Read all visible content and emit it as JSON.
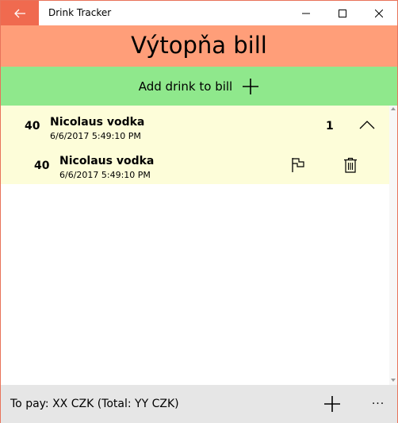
{
  "window": {
    "title": "Drink Tracker"
  },
  "header": {
    "title": "Výtopňa bill"
  },
  "add_bar": {
    "label": "Add drink to bill"
  },
  "group": {
    "quantity": "40",
    "name": "Nicolaus vodka",
    "time": "6/6/2017 5:49:10 PM",
    "count": "1"
  },
  "items": [
    {
      "quantity": "40",
      "name": "Nicolaus vodka",
      "time": "6/6/2017 5:49:10 PM"
    }
  ],
  "footer": {
    "to_pay": "To pay: XX CZK (Total: YY CZK)",
    "more": "···"
  },
  "colors": {
    "back_button": "#f06a4f",
    "header": "#ff9e79",
    "add_bar": "#8fe88c",
    "list_group": "#fdfdd9",
    "footer": "#e6e6e6"
  },
  "icons": [
    "back-arrow-icon",
    "minimize-icon",
    "maximize-icon",
    "close-icon",
    "plus-icon",
    "chevron-up-icon",
    "flag-icon",
    "trash-icon",
    "more-icon"
  ]
}
